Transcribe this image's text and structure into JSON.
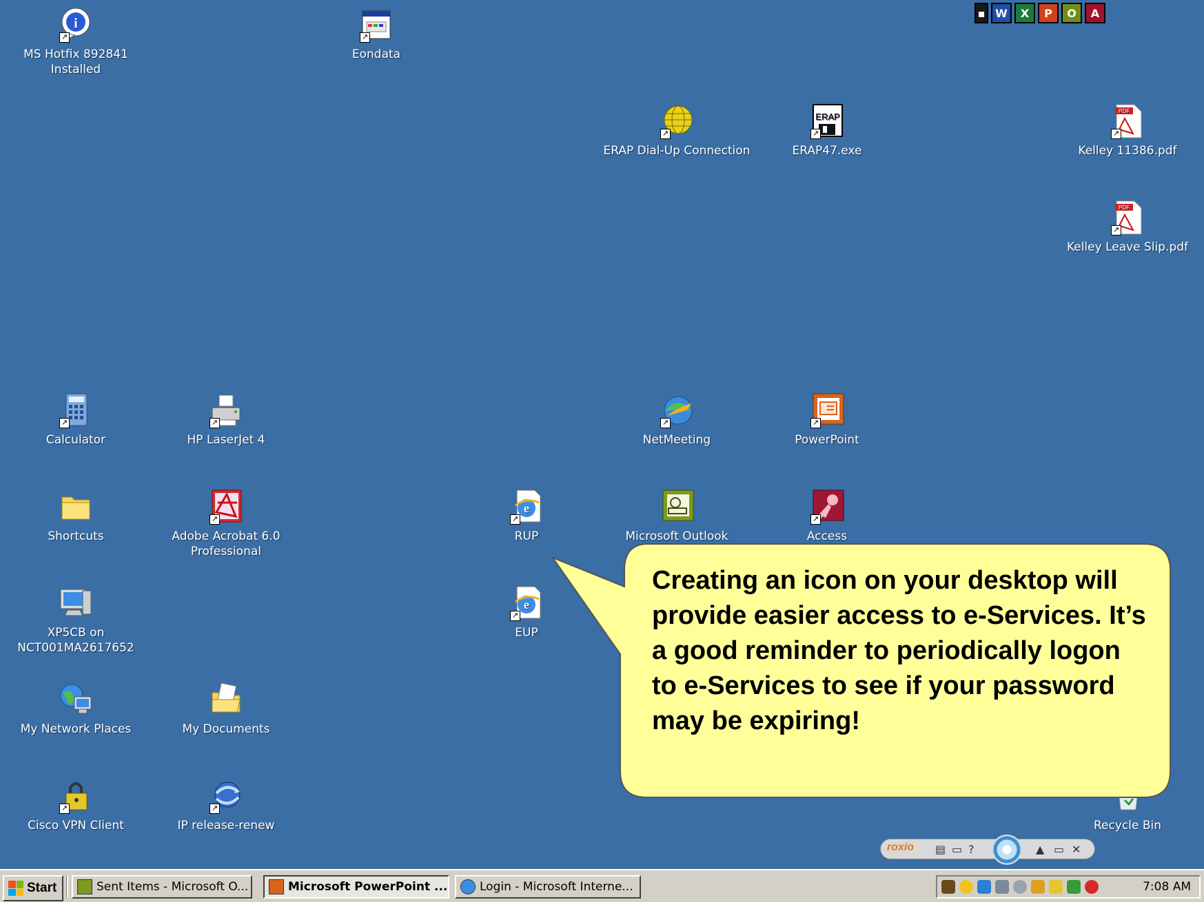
{
  "desktop": {
    "icons": [
      {
        "id": "ms-hotfix",
        "label": "MS Hotfix 892841\nInstalled",
        "icon": "info-icon"
      },
      {
        "id": "eondata",
        "label": "Eondata",
        "icon": "window-app-icon"
      },
      {
        "id": "erap-dialup",
        "label": "ERAP Dial-Up Connection",
        "icon": "globe-icon"
      },
      {
        "id": "erap47",
        "label": "ERAP47.exe",
        "icon": "floppy-icon"
      },
      {
        "id": "kelley-11386",
        "label": "Kelley 11386.pdf",
        "icon": "pdf-icon"
      },
      {
        "id": "kelley-leave",
        "label": "Kelley Leave Slip.pdf",
        "icon": "pdf-icon"
      },
      {
        "id": "calculator",
        "label": "Calculator",
        "icon": "calculator-icon"
      },
      {
        "id": "hp-laserjet",
        "label": "HP LaserJet 4",
        "icon": "printer-icon"
      },
      {
        "id": "netmeeting",
        "label": "NetMeeting",
        "icon": "netmeeting-icon"
      },
      {
        "id": "powerpoint",
        "label": "PowerPoint",
        "icon": "powerpoint-icon"
      },
      {
        "id": "shortcuts",
        "label": "Shortcuts",
        "icon": "folder-icon"
      },
      {
        "id": "acrobat",
        "label": "Adobe Acrobat 6.0\nProfessional",
        "icon": "acrobat-icon"
      },
      {
        "id": "rup",
        "label": "RUP",
        "icon": "ie-page-icon"
      },
      {
        "id": "outlook",
        "label": "Microsoft Outlook",
        "icon": "outlook-icon"
      },
      {
        "id": "access",
        "label": "Access",
        "icon": "access-icon"
      },
      {
        "id": "xp5cb",
        "label": "XP5CB on\nNCT001MA2617652",
        "icon": "computer-icon"
      },
      {
        "id": "eup",
        "label": "EUP",
        "icon": "ie-page-icon"
      },
      {
        "id": "network-places",
        "label": "My Network Places",
        "icon": "network-icon"
      },
      {
        "id": "my-documents",
        "label": "My Documents",
        "icon": "documents-folder-icon"
      },
      {
        "id": "cisco-vpn",
        "label": "Cisco VPN Client",
        "icon": "lock-icon"
      },
      {
        "id": "ip-release",
        "label": "IP release-renew",
        "icon": "refresh-globe-icon"
      },
      {
        "id": "recycle-bin",
        "label": "Recycle Bin",
        "icon": "recycle-bin-icon"
      }
    ],
    "quick_launch": [
      {
        "icon": "office-icon",
        "color": "#1a1a1a"
      },
      {
        "icon": "word-icon",
        "color": "#1f4fa8"
      },
      {
        "icon": "excel-icon",
        "color": "#1e7a3c"
      },
      {
        "icon": "powerpoint-icon",
        "color": "#d0421b"
      },
      {
        "icon": "outlook-icon",
        "color": "#6f8f1a"
      },
      {
        "icon": "access-icon",
        "color": "#a3122a"
      }
    ]
  },
  "callout": {
    "text": "Creating an icon on your desktop will provide easier access to  e-Services.  It’s a good reminder to periodically logon to e-Services to see if your password may be expiring!",
    "fill": "#FFFF99"
  },
  "roxio": {
    "brand": "roxio"
  },
  "taskbar": {
    "start_label": "Start",
    "tasks": [
      {
        "label": "Sent Items - Microsoft O...",
        "icon": "outlook-icon",
        "active": false
      },
      {
        "label": "Microsoft PowerPoint ...",
        "icon": "powerpoint-icon",
        "active": true
      },
      {
        "label": "Login - Microsoft Interne...",
        "icon": "ie-icon",
        "active": false
      }
    ],
    "clock": "7:08 AM"
  }
}
